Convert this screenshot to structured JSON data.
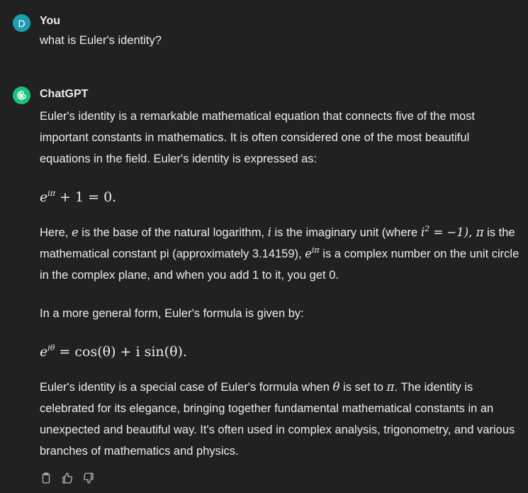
{
  "user": {
    "avatar_letter": "D",
    "name": "You",
    "message": "what is Euler's identity?"
  },
  "assistant": {
    "name": "ChatGPT",
    "p1": "Euler's identity is a remarkable mathematical equation that connects five of the most important constants in mathematics. It is often considered one of the most beautiful equations in the field. Euler's identity is expressed as:",
    "eq1": {
      "base": "e",
      "exp": "iπ",
      "rest": " + 1 = 0."
    },
    "p2": {
      "t1": "Here, ",
      "m_e": "e",
      "t2": " is the base of the natural logarithm, ",
      "m_i": "i",
      "t3": " is the imaginary unit (where ",
      "m_i2_base": "i",
      "m_i2_exp": "2",
      "m_eq": " = −1), ",
      "m_pi": "π",
      "t4": " is the mathematical constant pi (approximately 3.14159), ",
      "m_eip_base": "e",
      "m_eip_exp": "iπ",
      "t5": " is a complex number on the unit circle in the complex plane, and when you add 1 to it, you get 0."
    },
    "p3": "In a more general form, Euler's formula is given by:",
    "eq2": {
      "base": "e",
      "exp": "iθ",
      "rest": " = cos(θ) + i sin(θ)."
    },
    "p4": {
      "t1": "Euler's identity is a special case of Euler's formula when ",
      "m_theta": "θ",
      "t2": " is set to ",
      "m_pi": "π",
      "t3": ". The identity is celebrated for its elegance, bringing together fundamental mathematical constants in an unexpected and beautiful way. It's often used in complex analysis, trigonometry, and various branches of mathematics and physics."
    }
  },
  "actions": [
    {
      "icon": "clipboard-icon"
    },
    {
      "icon": "thumbs-up-icon"
    },
    {
      "icon": "thumbs-down-icon"
    }
  ]
}
